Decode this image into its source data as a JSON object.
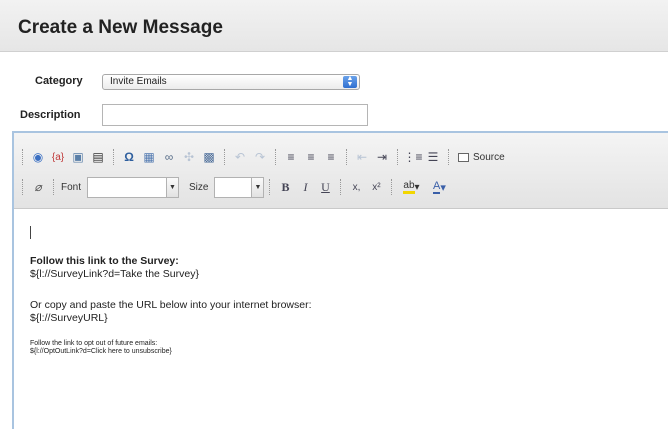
{
  "header": {
    "title": "Create a New Message"
  },
  "form": {
    "category_label": "Category",
    "category_value": "Invite Emails",
    "description_label": "Description",
    "description_value": ""
  },
  "toolbar": {
    "row1_icons": [
      "globe-icon",
      "placeholder-field-icon",
      "image-icon",
      "save-template-icon",
      "omega-special-char-icon",
      "table-icon",
      "link-icon",
      "unlink-icon",
      "paste-icon",
      "undo-icon",
      "redo-icon",
      "align-left-icon",
      "align-center-icon",
      "align-right-icon",
      "outdent-icon",
      "indent-icon",
      "numbered-list-icon",
      "bulleted-list-icon"
    ],
    "source_label": "Source",
    "font_label": "Font",
    "font_value": "",
    "size_label": "Size",
    "size_value": "",
    "bold_glyph": "B",
    "italic_glyph": "I",
    "underline_glyph": "U",
    "subscript_glyph": "x,",
    "superscript_glyph": "x²"
  },
  "body": {
    "para1_line1": "Follow this link to the Survey:",
    "para1_line2": "${l://SurveyLink?d=Take the Survey}",
    "para2_line1": "Or copy and paste the URL below into your internet browser:",
    "para2_line2": "${l://SurveyURL}",
    "para3_line1": "Follow the link to opt out of future emails:",
    "para3_line2": "${l://OptOutLink?d=Click here to unsubscribe}"
  }
}
